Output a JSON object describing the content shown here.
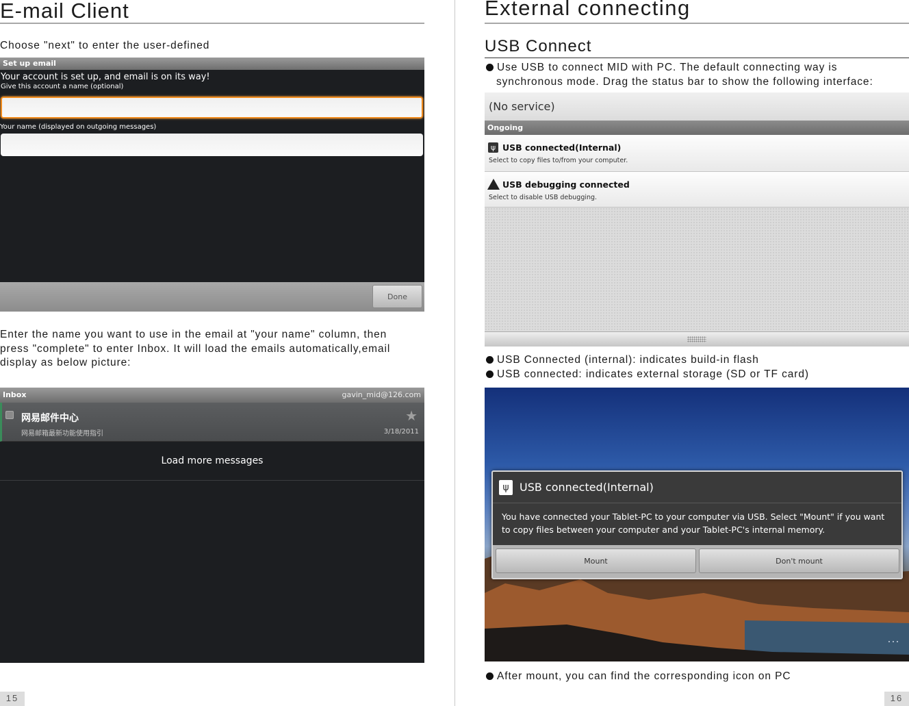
{
  "left": {
    "title": "E-mail Client",
    "intro": "Choose \"next\" to enter the user-defined",
    "setup_screen": {
      "bar_title": "Set up email",
      "heading": "Your account is set up, and email is on its way!",
      "name_label": "Give this account a name (optional)",
      "your_name_label": "Your name (displayed on outgoing messages)",
      "done_button": "Done"
    },
    "para_lines": [
      "Enter the name you want to use in the email at \"your name\" column, then",
      "press \"complete\" to enter Inbox. It will load the emails automatically,email",
      "display as below picture:"
    ],
    "inbox_screen": {
      "bar_title": "Inbox",
      "account": "gavin_mid@126.com",
      "message_sender": "网易邮件中心",
      "message_subject": "网易邮箱最新功能使用指引",
      "message_date": "3/18/2011",
      "load_more": "Load more messages"
    },
    "page_number": "15"
  },
  "right": {
    "title": "External connecting",
    "subtitle": "USB Connect",
    "bullet1_line1": "Use USB to connect MID with PC. The default connecting way is",
    "bullet1_line2": "synchronous mode. Drag the status bar to show the following interface:",
    "status_screen": {
      "carrier": "(No service)",
      "section": "Ongoing",
      "notif1_title": "USB connected(Internal)",
      "notif1_sub": "Select to copy files to/from your computer.",
      "notif2_title": "USB debugging connected",
      "notif2_sub": "Select to disable USB debugging."
    },
    "bullet2": "USB Connected (internal): indicates build-in flash",
    "bullet3": "USB connected: indicates external storage (SD or TF card)",
    "dialog": {
      "title": "USB connected(Internal)",
      "body_line1": "You have connected your Tablet-PC to your computer via USB. Select \"Mount\" if you want",
      "body_line2": "to copy files between your computer and your Tablet-PC's internal memory.",
      "mount_button": "Mount",
      "dont_mount_button": "Don't mount"
    },
    "bullet4": "After mount, you can find the corresponding icon on PC",
    "page_number": "16"
  },
  "colors": {
    "screen_dark": "#1c1e21",
    "focus_orange": "#f08a1c",
    "rule_gray": "#a8a8a8"
  },
  "icons": [
    "usb-icon",
    "warning-icon",
    "star-icon",
    "checkbox-icon"
  ]
}
